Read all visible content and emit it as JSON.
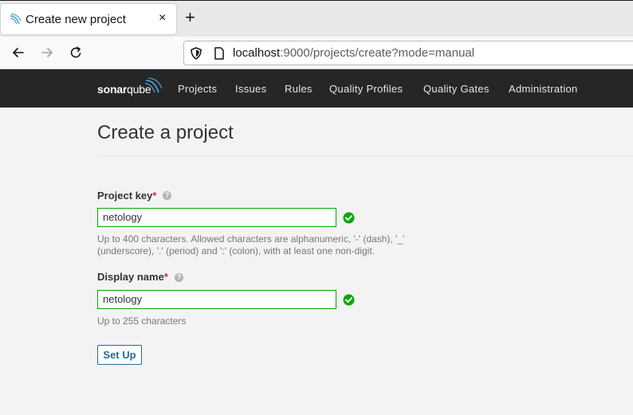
{
  "browser": {
    "tab_title": "Create new project",
    "tab_close": "×",
    "new_tab": "+",
    "url_host": "localhost",
    "url_rest": ":9000/projects/create?mode=manual"
  },
  "sonar": {
    "logo_bold": "sonar",
    "logo_light": "qube",
    "nav": [
      "Projects",
      "Issues",
      "Rules",
      "Quality Profiles",
      "Quality Gates",
      "Administration"
    ]
  },
  "page": {
    "title": "Create a project",
    "project_key": {
      "label": "Project key",
      "required_mark": "*",
      "help": "?",
      "value": "netology",
      "hint_line1": "Up to 400 characters. Allowed characters are alphanumeric, '-' (dash), '_'",
      "hint_line2": "(underscore), '.' (period) and ':' (colon), with at least one non-digit."
    },
    "display_name": {
      "label": "Display name",
      "required_mark": "*",
      "help": "?",
      "value": "netology",
      "hint": "Up to 255 characters"
    },
    "setup_label": "Set Up"
  },
  "colors": {
    "header_bg": "#262626",
    "valid_green": "#00aa00",
    "primary_blue": "#236a97",
    "required_red": "#d02f3a"
  }
}
